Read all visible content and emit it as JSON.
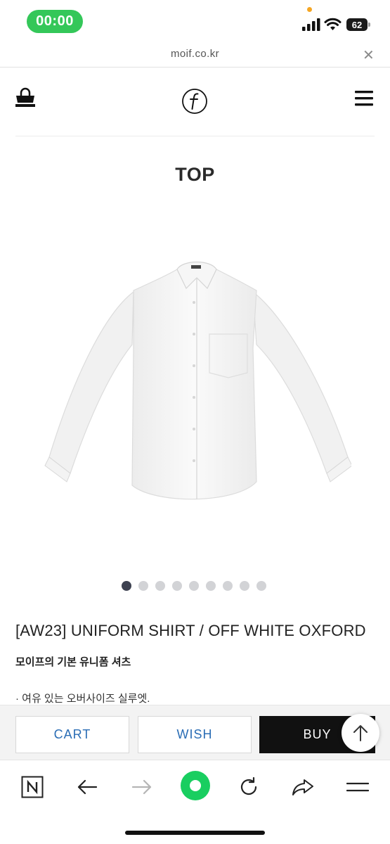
{
  "status_bar": {
    "time": "00:00",
    "battery": "62",
    "icons": [
      "signal-icon",
      "wifi-icon",
      "battery-icon"
    ],
    "time_pill_color": "#34c759"
  },
  "url_bar": {
    "url": "moif.co.kr",
    "close_icon": "close-icon"
  },
  "header": {
    "icons": [
      "shopping-bag-icon",
      "moif-logo-icon",
      "hamburger-menu-icon"
    ]
  },
  "category": {
    "title": "TOP"
  },
  "product": {
    "image": "white-oxford-shirt-photo",
    "carousel": {
      "total": 9,
      "active": 1
    },
    "name": "[AW23] UNIFORM SHIRT / OFF WHITE OXFORD",
    "subtitle": "모이프의 기본 유니폼 셔츠",
    "description": "· 여유 있는 오버사이즈 실루엣."
  },
  "actions": {
    "cart_label": "CART",
    "wish_label": "WISH",
    "buy_label": "BUY",
    "scroll_top_icon": "arrow-up-icon",
    "accent_color": "#2a6db5"
  },
  "browser_toolbar": {
    "icons": [
      "naver-n-icon",
      "back-arrow-icon",
      "forward-arrow-icon",
      "green-home-icon",
      "reload-icon",
      "share-icon",
      "menu-icon"
    ],
    "home_color": "#19ce60"
  }
}
